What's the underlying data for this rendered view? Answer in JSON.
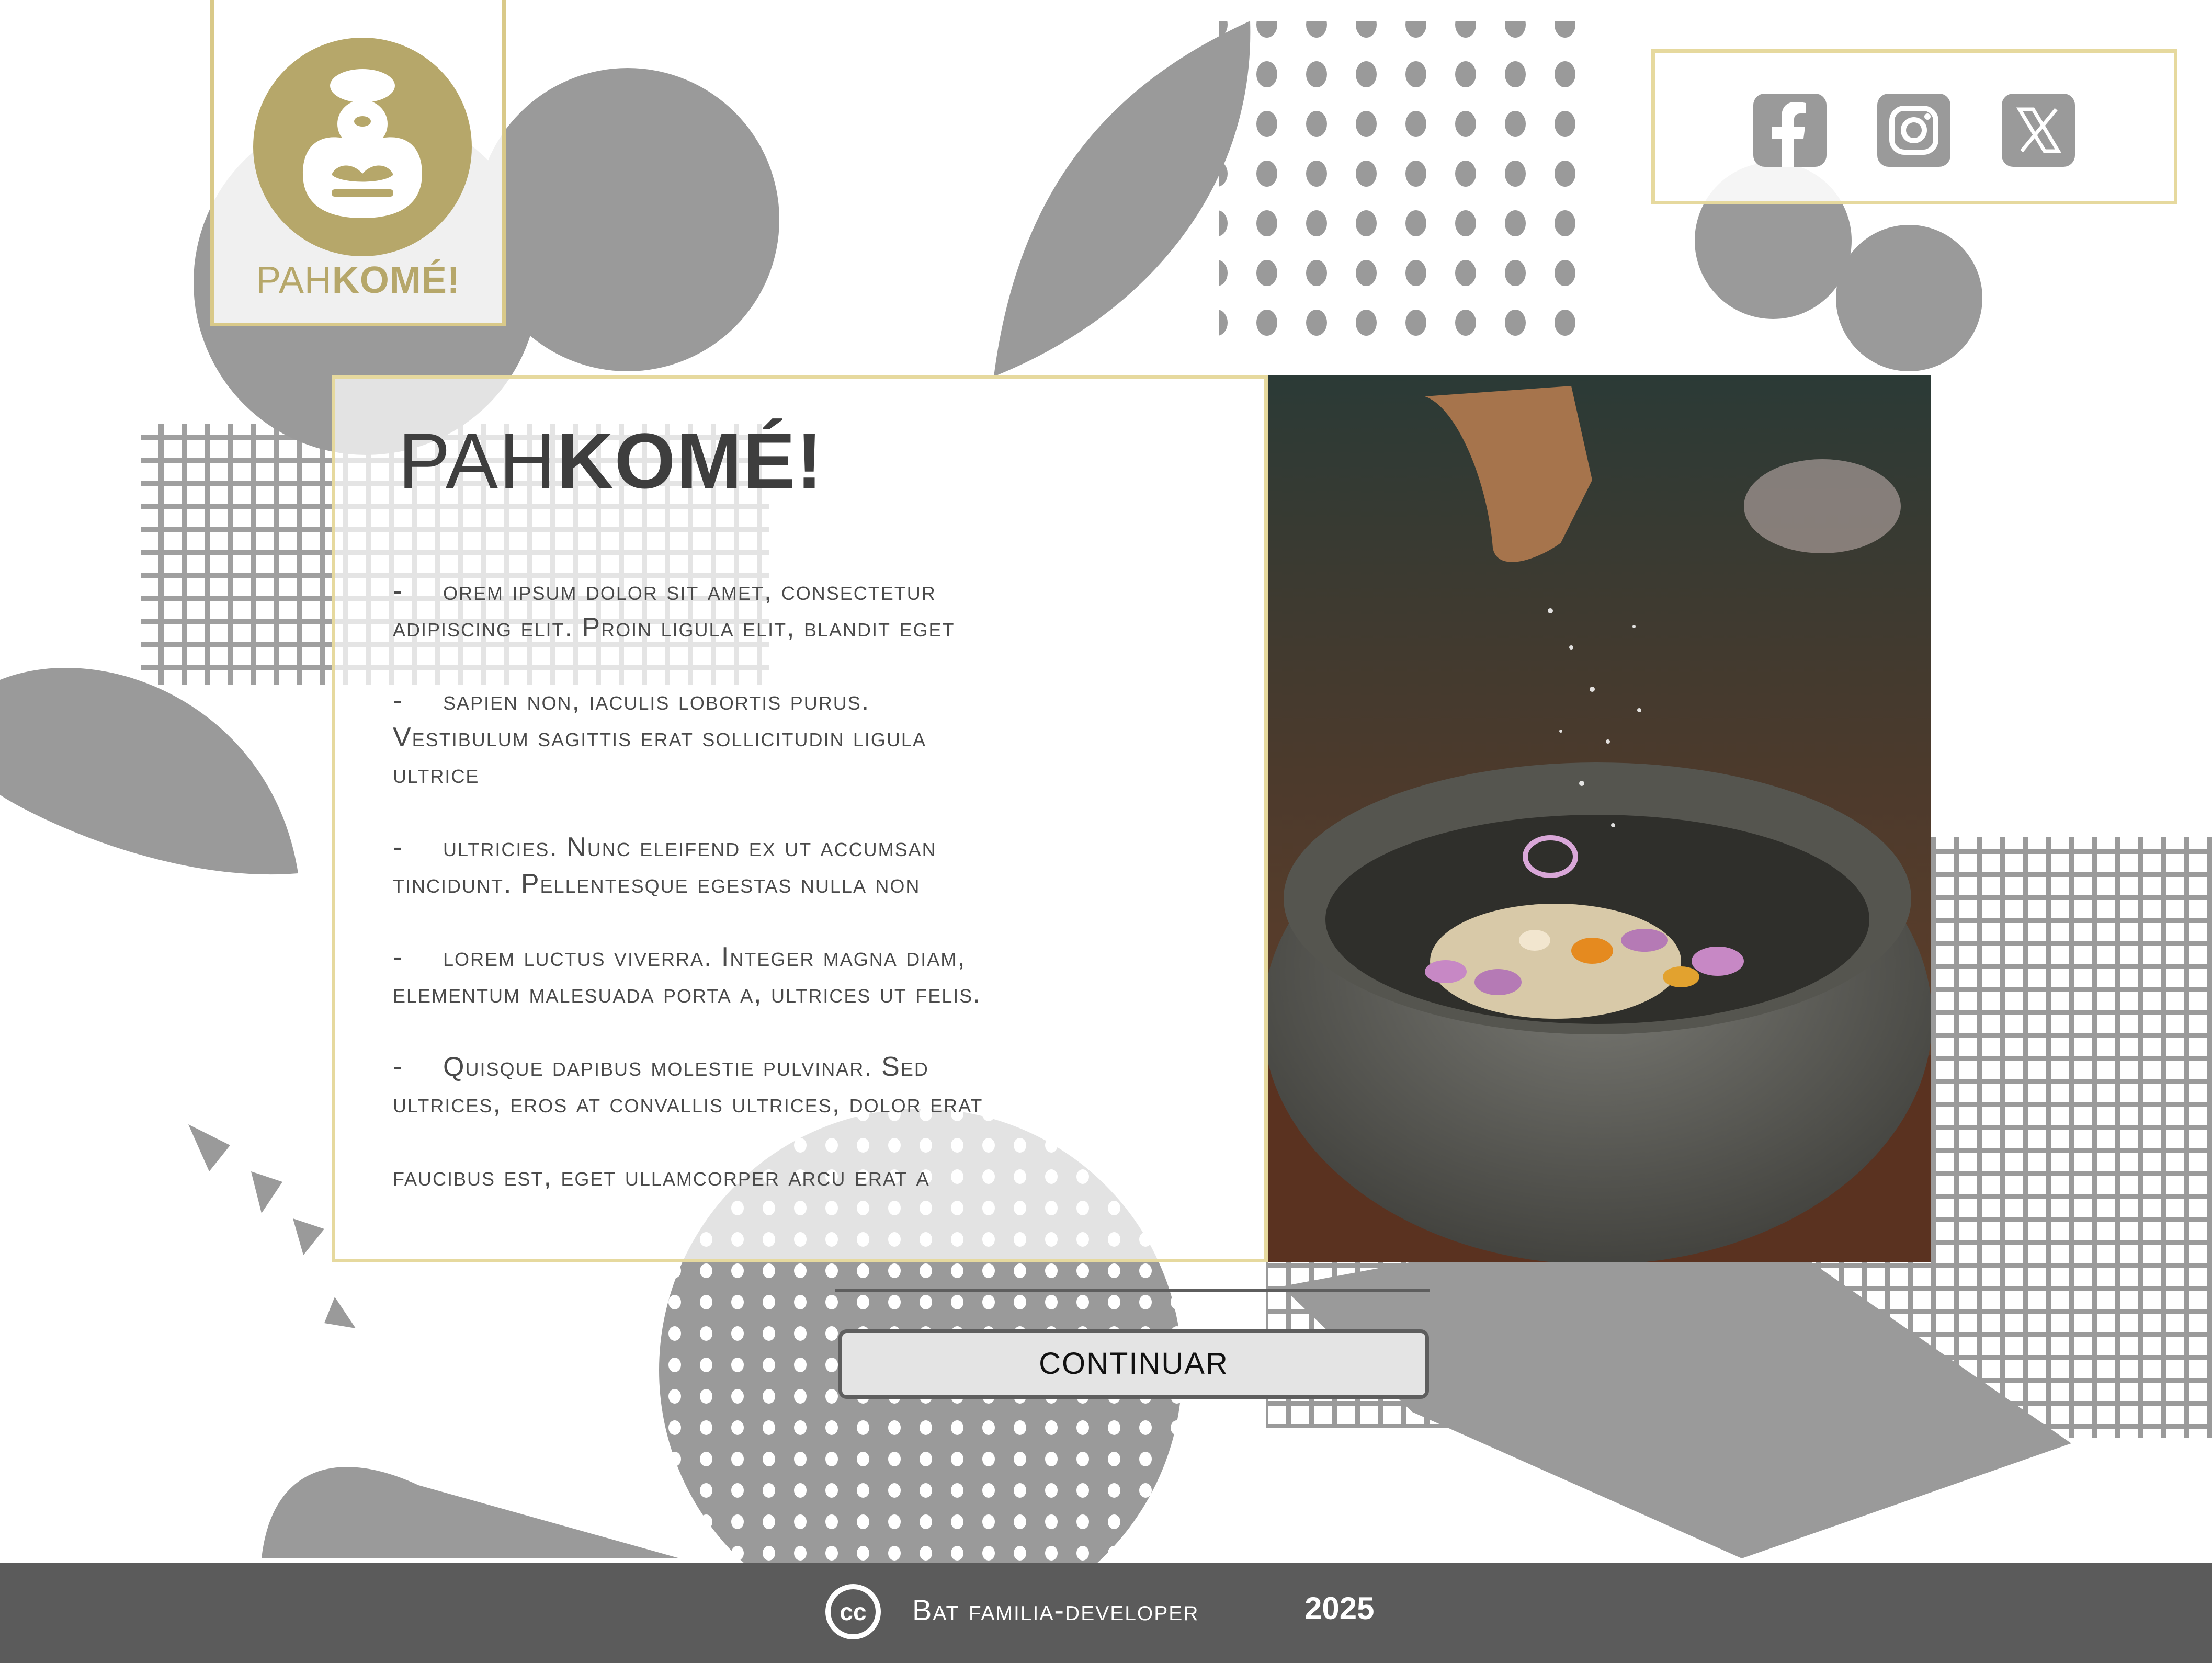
{
  "logo": {
    "text_light": "PAH",
    "text_bold": "KOMÉ!"
  },
  "social": [
    {
      "name": "facebook-icon",
      "glyph": "f"
    },
    {
      "name": "instagram-icon",
      "glyph": ""
    },
    {
      "name": "x-icon",
      "glyph": "X"
    }
  ],
  "card": {
    "title_light": "PAH",
    "title_bold": "KOMÉ!",
    "paragraphs": [
      {
        "dash": "-",
        "text": "orem ipsum dolor sit amet, consectetur\nadipiscing elit. Proin ligula elit, blandit eget"
      },
      {
        "dash": "-",
        "text": "sapien non, iaculis lobortis purus.\nVestibulum sagittis erat sollicitudin ligula\nultrice"
      },
      {
        "dash": "-",
        "text": "ultricies. Nunc eleifend ex ut accumsan\ntincidunt. Pellentesque egestas nulla non"
      },
      {
        "dash": "-",
        "text": "lorem luctus viverra. Integer magna diam,\nelementum malesuada porta a, ultrices ut felis."
      },
      {
        "dash": "-",
        "text": "Quisque dapibus molestie pulvinar. Sed\nultrices, eros at convallis ultrices, dolor erat"
      },
      {
        "dash": "",
        "text": "faucibus est, eget ullamcorper arcu erat a"
      }
    ]
  },
  "continue_label": "CONTINUAR",
  "footer": {
    "cc": "cc",
    "text": "Bat familia-developer",
    "year": "2025"
  },
  "colors": {
    "gold": "#b6a76a",
    "gold_border": "#e6d99e",
    "gray_shapes": "#9a9a9a",
    "footer": "#5b5b5b"
  }
}
